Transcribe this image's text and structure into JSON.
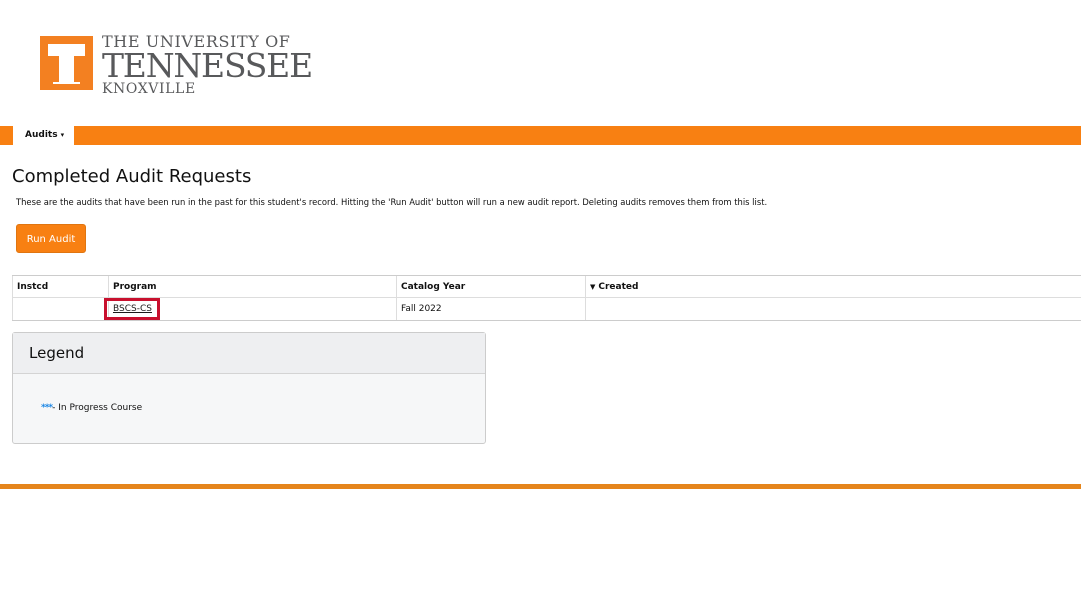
{
  "logo": {
    "line1": "THE UNIVERSITY OF",
    "line2": "TENNESSEE",
    "line3": "KNOXVILLE",
    "accent_color": "#f38021"
  },
  "nav": {
    "tab_label": "Audits",
    "caret_icon": "caret-down-icon",
    "bar_color": "#f88012"
  },
  "page": {
    "title": "Completed Audit Requests",
    "description": "These are the audits that have been run in the past for this student's record. Hitting the 'Run Audit' button will run a new audit report. Deleting audits removes them from this list.",
    "run_button": "Run Audit"
  },
  "table": {
    "columns": [
      "Instcd",
      "Program",
      "Catalog Year",
      "Created"
    ],
    "sort_icon": "sort-desc-icon",
    "rows": [
      {
        "instcd": "",
        "program": "BSCS-CS",
        "catalog_year": "Fall 2022",
        "created": ""
      }
    ],
    "highlight_color": "#c8102e"
  },
  "legend": {
    "title": "Legend",
    "marker": "***",
    "marker_color": "#1e88e5",
    "item": "- In Progress Course"
  }
}
